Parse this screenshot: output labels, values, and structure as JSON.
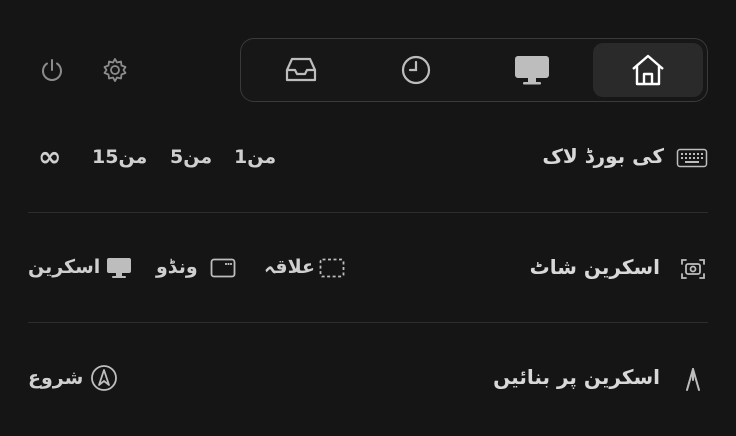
{
  "toolbar": {
    "icons": [
      "power-icon",
      "gear-icon"
    ]
  },
  "tabs": [
    {
      "icon": "tray-icon"
    },
    {
      "icon": "clock-icon"
    },
    {
      "icon": "monitor-icon"
    },
    {
      "icon": "home-icon",
      "active": true
    }
  ],
  "keyboard_lock": {
    "label": "کی بورڈ لاک",
    "options": [
      "1من",
      "5من",
      "15من",
      "∞"
    ]
  },
  "screenshot": {
    "label": "اسکرین شاٹ",
    "options": [
      {
        "label": "علاقہ",
        "icon": "region-icon"
      },
      {
        "label": "ونڈو",
        "icon": "window-icon"
      },
      {
        "label": "اسکرین",
        "icon": "display-icon"
      }
    ]
  },
  "draw": {
    "label": "اسکرین پر بنائیں",
    "start_label": "شروع"
  },
  "colors": {
    "background": "#151515",
    "text": "#d4d4d4",
    "active_tab": "#2a2a2a"
  }
}
